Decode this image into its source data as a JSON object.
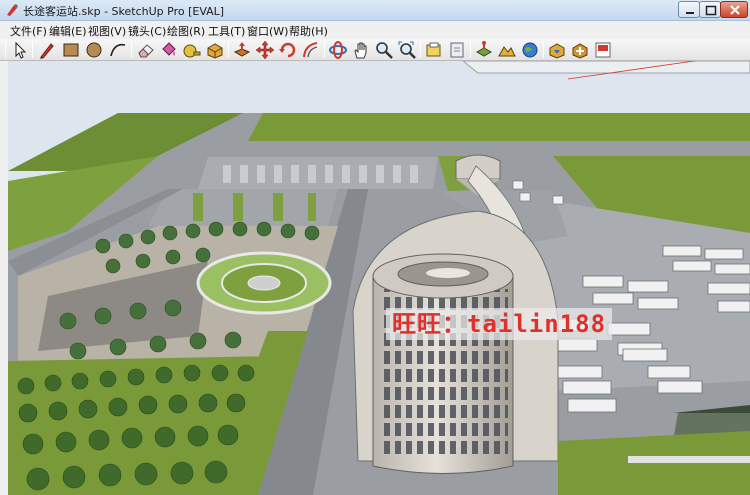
{
  "window": {
    "title": "长途客运站.skp - SketchUp Pro [EVAL]"
  },
  "menu": [
    {
      "label": "文件(F)"
    },
    {
      "label": "编辑(E)"
    },
    {
      "label": "视图(V)"
    },
    {
      "label": "镜头(C)"
    },
    {
      "label": "绘图(R)"
    },
    {
      "label": "工具(T)"
    },
    {
      "label": "窗口(W)"
    },
    {
      "label": "帮助(H)"
    }
  ],
  "toolbar": {
    "tools": [
      {
        "icon": "select-arrow-icon"
      },
      {
        "icon": "pencil-line-icon"
      },
      {
        "icon": "rectangle-icon"
      },
      {
        "icon": "circle-icon"
      },
      {
        "icon": "arc-icon"
      },
      {
        "icon": "eraser-icon"
      },
      {
        "icon": "paint-bucket-icon"
      },
      {
        "icon": "tape-measure-icon"
      },
      {
        "icon": "make-component-icon"
      },
      {
        "icon": "push-pull-icon"
      },
      {
        "icon": "move-icon"
      },
      {
        "icon": "rotate-icon"
      },
      {
        "icon": "offset-icon"
      },
      {
        "icon": "orbit-icon"
      },
      {
        "icon": "pan-icon"
      },
      {
        "icon": "zoom-icon"
      },
      {
        "icon": "zoom-extents-icon"
      },
      {
        "icon": "get-models-icon"
      },
      {
        "icon": "share-model-icon"
      },
      {
        "icon": "add-location-icon"
      },
      {
        "icon": "toggle-terrain-icon"
      },
      {
        "icon": "google-earth-icon"
      },
      {
        "icon": "warehouse-icon"
      },
      {
        "icon": "extension-warehouse-icon"
      },
      {
        "icon": "layout-icon"
      }
    ]
  },
  "watermark": {
    "text": "旺旺：tailin188"
  },
  "colors": {
    "sky": "#dde6ef",
    "grass": "#7a9a3a",
    "road": "#8f9398",
    "building": "#d8d4cc",
    "watermark_text": "#e0302c"
  }
}
